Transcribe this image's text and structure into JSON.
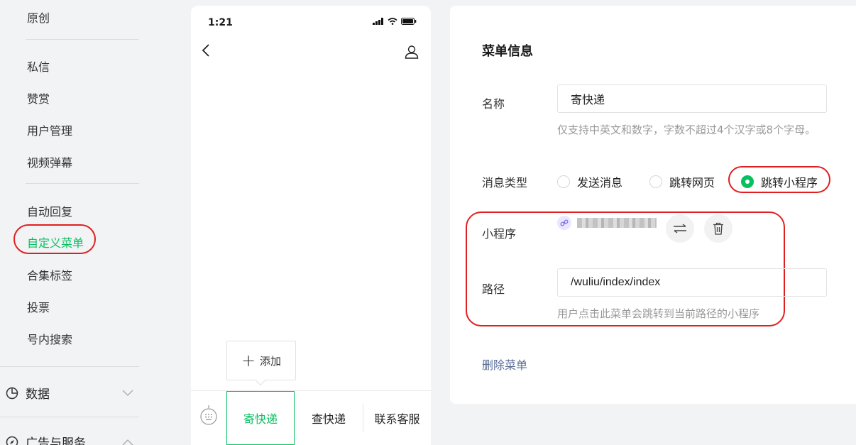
{
  "sidebar": {
    "items": [
      {
        "label": "原创"
      },
      {
        "label": "私信"
      },
      {
        "label": "赞赏"
      },
      {
        "label": "用户管理"
      },
      {
        "label": "视频弹幕"
      },
      {
        "label": "自动回复"
      },
      {
        "label": "自定义菜单"
      },
      {
        "label": "合集标签"
      },
      {
        "label": "投票"
      },
      {
        "label": "号内搜索"
      }
    ],
    "sections": [
      {
        "label": "数据"
      },
      {
        "label": "广告与服务"
      }
    ]
  },
  "phone": {
    "time": "1:21",
    "add_label": "添加",
    "menus": [
      "寄快递",
      "查快递",
      "联系客服"
    ]
  },
  "form": {
    "title": "菜单信息",
    "name_label": "名称",
    "name_value": "寄快递",
    "name_hint": "仅支持中英文和数字，字数不超过4个汉字或8个字母。",
    "type_label": "消息类型",
    "type_options": [
      "发送消息",
      "跳转网页",
      "跳转小程序"
    ],
    "type_selected": "跳转小程序",
    "mp_label": "小程序",
    "path_label": "路径",
    "path_value": "/wuliu/index/index",
    "path_hint": "用户点击此菜单会跳转到当前路径的小程序",
    "delete_label": "删除菜单"
  },
  "colors": {
    "accent": "#07c160",
    "annotation": "#e02020",
    "link": "#576b95"
  }
}
